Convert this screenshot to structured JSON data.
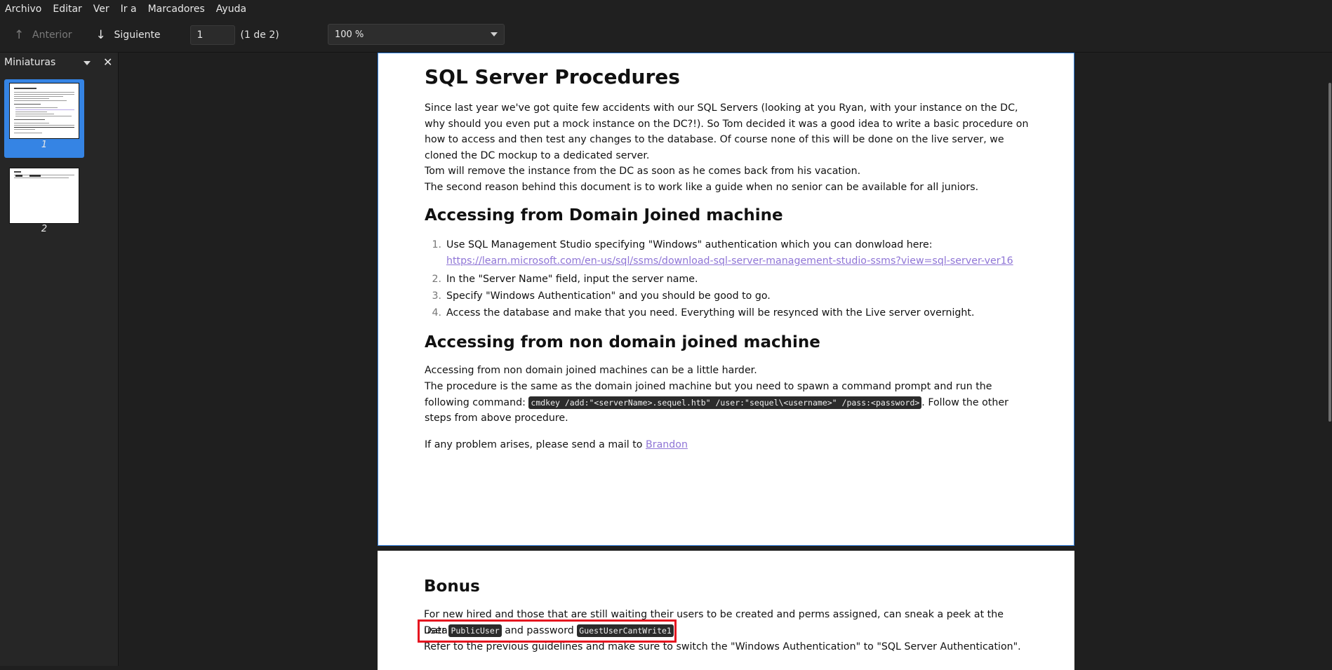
{
  "menu": [
    "Archivo",
    "Editar",
    "Ver",
    "Ir a",
    "Marcadores",
    "Ayuda"
  ],
  "toolbar": {
    "prev_label": "Anterior",
    "next_label": "Siguiente",
    "page_value": "1",
    "page_count": "(1 de 2)",
    "zoom_value": "100 %"
  },
  "sidebar": {
    "title": "Miniaturas",
    "thumbs": [
      {
        "label": "1",
        "selected": true
      },
      {
        "label": "2",
        "selected": false
      }
    ]
  },
  "doc": {
    "title": "SQL Server Procedures",
    "intro_1": "Since last year we've got quite few accidents with our SQL Servers (looking at you Ryan, with your instance on the DC, why should you even put a mock instance on the DC?!). So Tom decided it was a good idea to write a basic procedure on how to access and then test any changes to the database. Of course none of this will be done on the live server, we cloned the DC mockup to a dedicated server.",
    "intro_2": "Tom will remove the instance from the DC as soon as he comes back from his vacation.",
    "intro_3": "The second reason behind this document is to work like a guide when no senior can be available for all juniors.",
    "h_domain": "Accessing from Domain Joined machine",
    "list": [
      {
        "n": "1.",
        "text": "Use SQL Management Studio specifying \"Windows\" authentication which you can donwload here:",
        "link": "https://learn.microsoft.com/en-us/sql/ssms/download-sql-server-management-studio-ssms?view=sql-server-ver16"
      },
      {
        "n": "2.",
        "text": "In the \"Server Name\" field, input the server name."
      },
      {
        "n": "3.",
        "text": "Specify \"Windows Authentication\" and you should be good to go."
      },
      {
        "n": "4.",
        "text": "Access the database and make that you need. Everything will be resynced with the Live server overnight."
      }
    ],
    "h_nondomain": "Accessing from non domain joined machine",
    "nd_1": "Accessing from non domain joined machines can be a little harder.",
    "nd_2a": "The procedure is the same as the domain joined machine but you need to spawn a command prompt and run the following command: ",
    "nd_code": "cmdkey /add:\"<serverName>.sequel.htb\" /user:\"sequel\\<username>\" /pass:<password>",
    "nd_2b": ". Follow the other steps from above procedure.",
    "mail_text": "If any problem arises, please send a mail to ",
    "mail_link": "Brandon",
    "h_bonus": "Bonus",
    "bonus_1": "For new hired and those that are still waiting their users to be created and perms assigned, can sneak a peek at the Database with",
    "bonus_user_pre": "user ",
    "bonus_user": "PublicUser",
    "bonus_mid": " and password ",
    "bonus_pass": "GuestUserCantWrite1",
    "bonus_end": ".",
    "bonus_2": "Refer to the previous guidelines and make sure to switch the \"Windows Authentication\" to \"SQL Server Authentication\"."
  }
}
